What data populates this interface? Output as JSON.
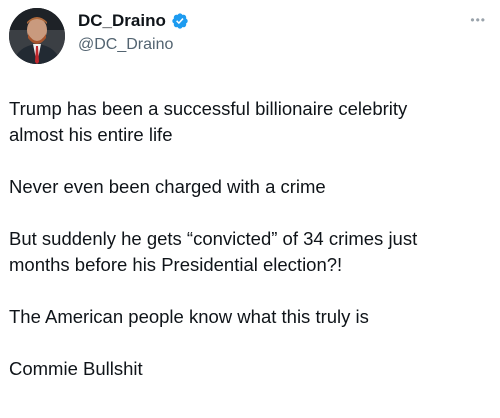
{
  "author": {
    "display_name": "DC_Draino",
    "handle": "@DC_Draino",
    "verified": true,
    "avatar": "profile-photo"
  },
  "menu": {
    "icon": "more-options-icon",
    "glyph": "•••"
  },
  "tweet": {
    "paragraphs": [
      "Trump has been a successful billionaire celebrity\nalmost his entire life",
      "Never even been charged with a crime",
      "But suddenly he gets “convicted” of 34 crimes just\nmonths before his Presidential election?!",
      "The American people know what this truly is",
      "Commie Bullshit"
    ]
  },
  "colors": {
    "text": "#0f1419",
    "secondary": "#536471",
    "verified_blue": "#1d9bf0"
  }
}
